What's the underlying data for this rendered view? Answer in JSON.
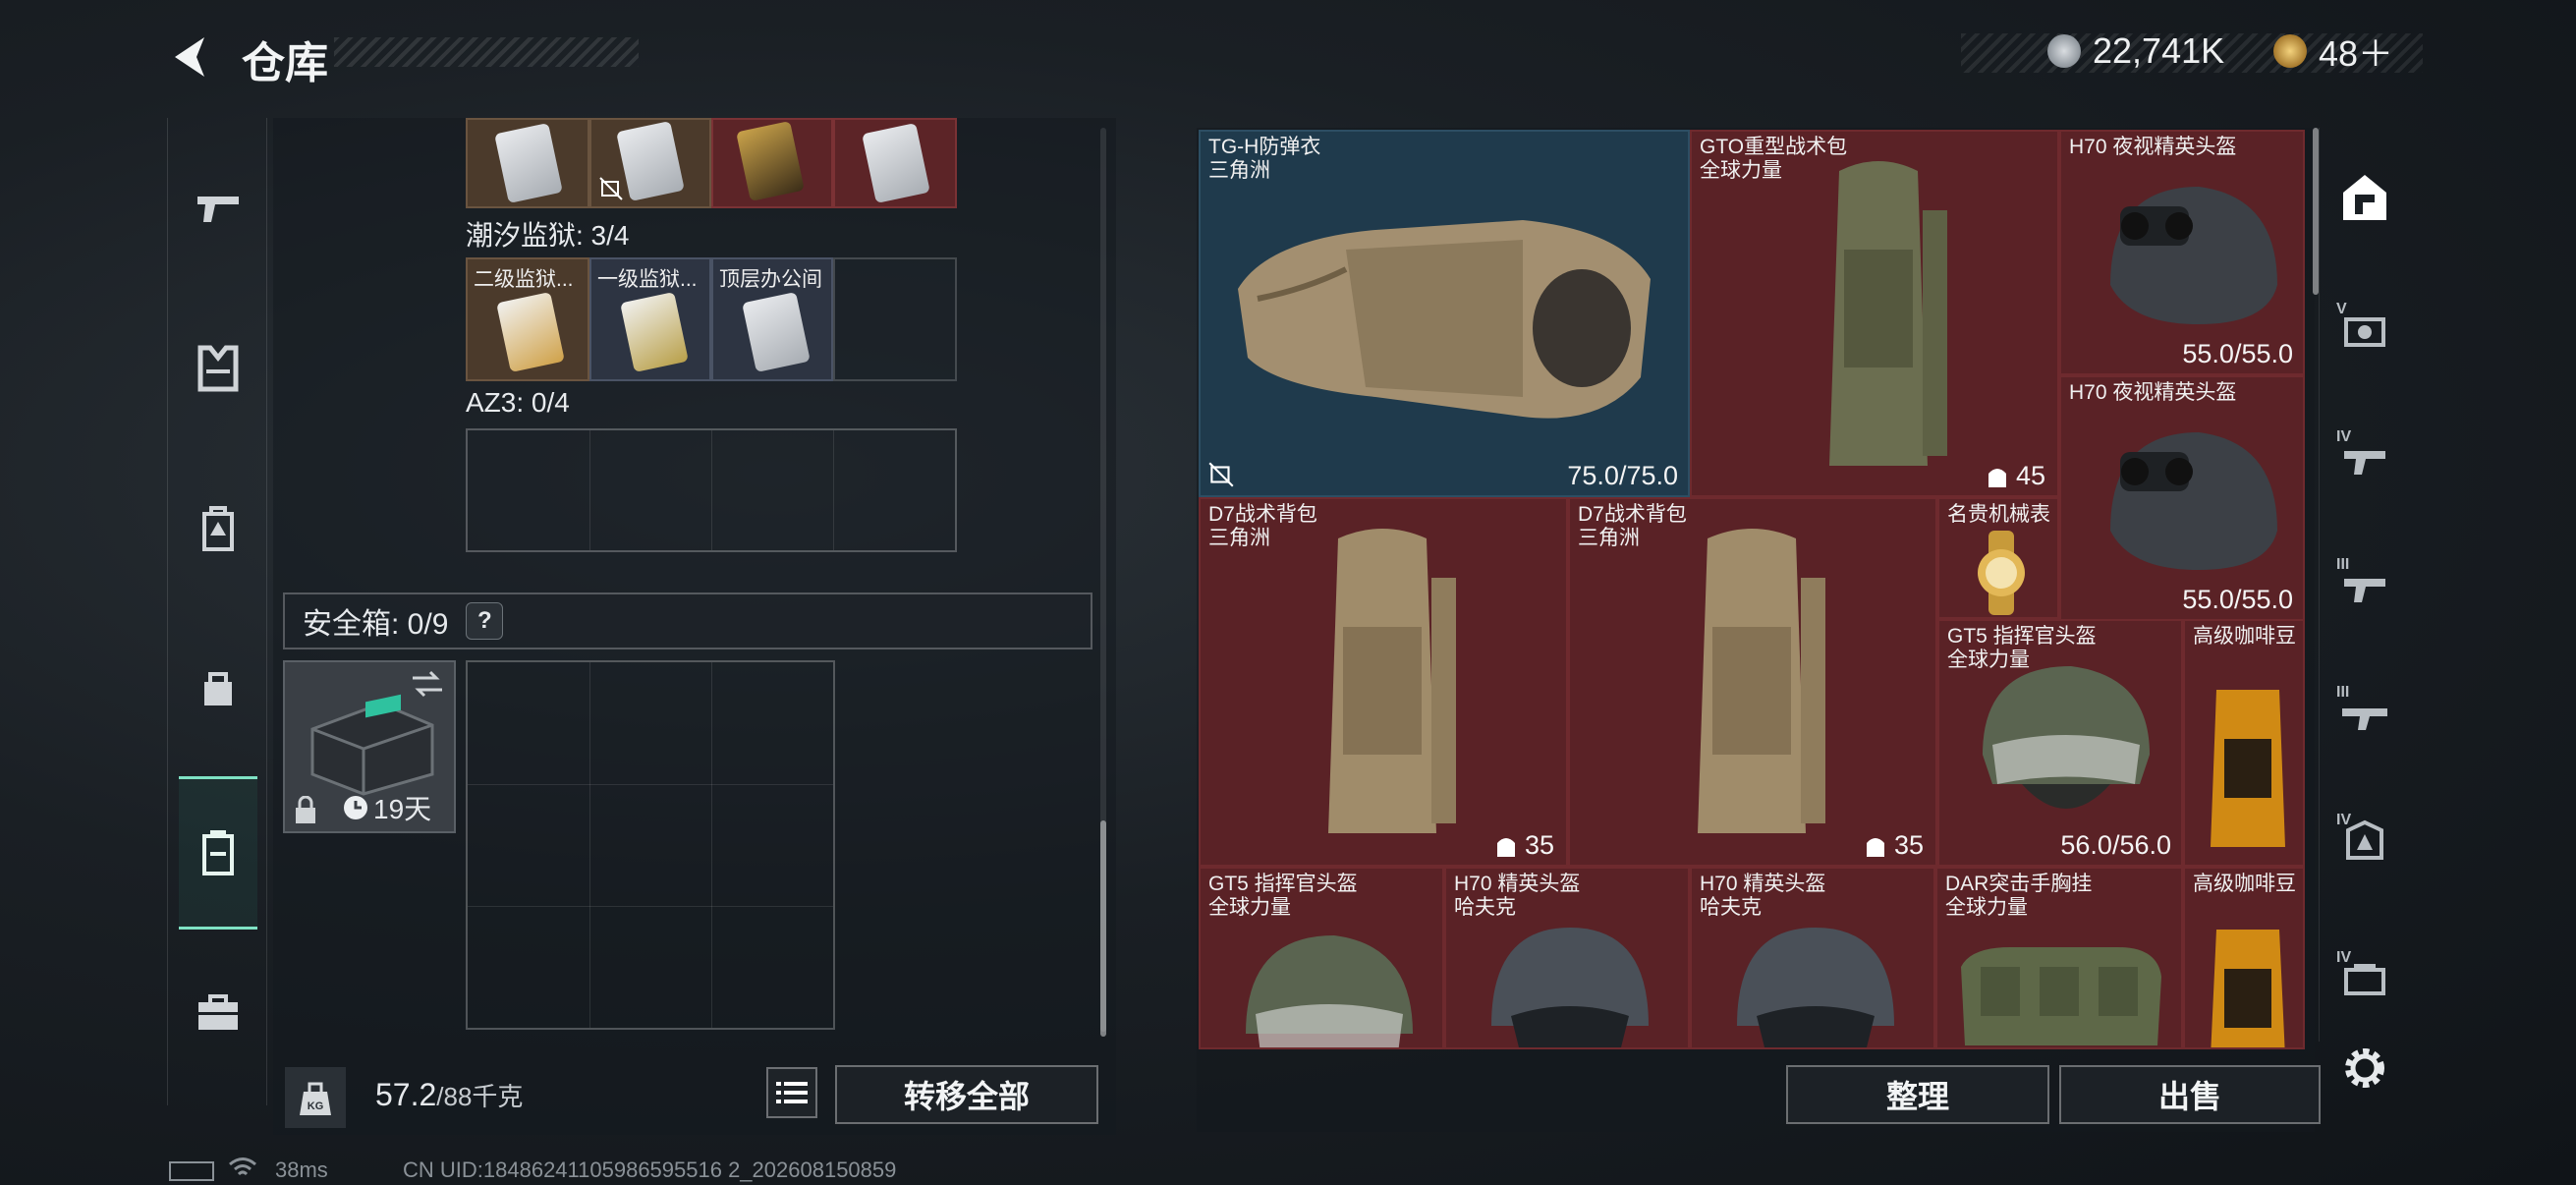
{
  "header": {
    "title": "仓库"
  },
  "currency": [
    {
      "icon": "silver-coin-icon",
      "value": "22,741K",
      "color": "#b8bec5"
    },
    {
      "icon": "gold-coin-icon",
      "value": "48＋",
      "color": "#d8b25a"
    }
  ],
  "left_nav": [
    {
      "icon": "pistol-icon"
    },
    {
      "icon": "vest-icon"
    },
    {
      "icon": "backpack-icon"
    },
    {
      "icon": "bag-icon"
    },
    {
      "icon": "case-icon",
      "active": true
    },
    {
      "icon": "toolbox-icon"
    }
  ],
  "keycards": {
    "top_row_label": "",
    "group1_label": "潮汐监狱: 3/4",
    "group1_slots": [
      "二级监狱...",
      "一级监狱...",
      "顶层办公间",
      ""
    ],
    "group2_label": "AZ3: 0/4"
  },
  "safebox": {
    "label": "安全箱: 0/9",
    "help": "?",
    "days": "19天"
  },
  "weight": {
    "current": "57.2",
    "max": "/88千克"
  },
  "buttons": {
    "transfer_all": "转移全部",
    "organize": "整理",
    "sell": "出售"
  },
  "stash_items": [
    {
      "name": "TG-H防弹衣",
      "sub": "三角洲",
      "value": "75.0/75.0"
    },
    {
      "name": "GTO重型战术包",
      "sub": "全球力量",
      "count": "45"
    },
    {
      "name": "H70 夜视精英头盔",
      "sub": "",
      "value": "55.0/55.0"
    },
    {
      "name": "H70 夜视精英头盔",
      "sub": "",
      "value": "55.0/55.0"
    },
    {
      "name": "D7战术背包",
      "sub": "三角洲",
      "count": "35"
    },
    {
      "name": "D7战术背包",
      "sub": "三角洲",
      "count": "35"
    },
    {
      "name": "名贵机械表",
      "sub": ""
    },
    {
      "name": "GT5 指挥官头盔",
      "sub": "全球力量",
      "value": "56.0/56.0"
    },
    {
      "name": "高级咖啡豆",
      "sub": ""
    },
    {
      "name": "GT5 指挥官头盔",
      "sub": "全球力量"
    },
    {
      "name": "H70 精英头盔",
      "sub": "哈夫克"
    },
    {
      "name": "H70 精英头盔",
      "sub": "哈夫克"
    },
    {
      "name": "DAR突击手胸挂",
      "sub": "全球力量"
    },
    {
      "name": "高级咖啡豆",
      "sub": ""
    }
  ],
  "right_tabs": [
    {
      "icon": "stash-home-icon",
      "tier": ""
    },
    {
      "icon": "tier-v-armor-icon",
      "tier": "V"
    },
    {
      "icon": "tier-iv-gun-icon",
      "tier": "IV"
    },
    {
      "icon": "tier-iii-gun-icon",
      "tier": "III"
    },
    {
      "icon": "tier-iii-rifle-icon",
      "tier": "III"
    },
    {
      "icon": "tier-iv-vest-icon",
      "tier": "IV"
    },
    {
      "icon": "tier-iv-item-icon",
      "tier": "IV"
    }
  ],
  "status_bar": {
    "ping": "38ms",
    "uid": "CN UID:18486241105986595516 2_202608150859"
  }
}
